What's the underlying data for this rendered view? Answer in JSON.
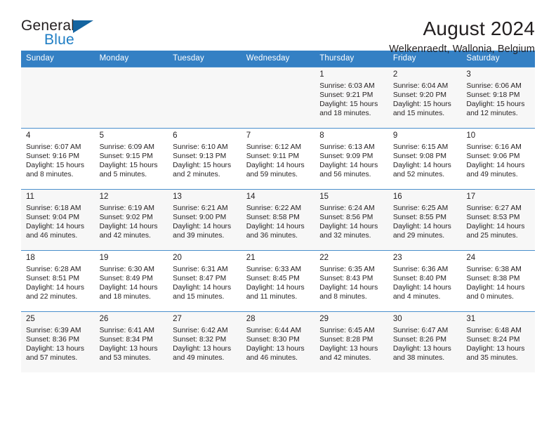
{
  "brand": {
    "name_part1": "General",
    "name_part2": "Blue",
    "accent_color": "#1f7ec4",
    "triangle_color": "#1464a0"
  },
  "header": {
    "title": "August 2024",
    "subtitle": "Welkenraedt, Wallonia, Belgium"
  },
  "theme": {
    "header_row_bg": "#3480c4",
    "header_row_text": "#ffffff",
    "row_shaded_bg": "#f7f7f7",
    "grid_line": "#4a8fcc",
    "text": "#231f20"
  },
  "columns": [
    "Sunday",
    "Monday",
    "Tuesday",
    "Wednesday",
    "Thursday",
    "Friday",
    "Saturday"
  ],
  "labels": {
    "sunrise": "Sunrise:",
    "sunset": "Sunset:",
    "daylight": "Daylight:"
  },
  "weeks": [
    [
      {
        "day": "",
        "detail": ""
      },
      {
        "day": "",
        "detail": ""
      },
      {
        "day": "",
        "detail": ""
      },
      {
        "day": "",
        "detail": ""
      },
      {
        "day": "1",
        "detail": "Sunrise: 6:03 AM\nSunset: 9:21 PM\nDaylight: 15 hours\nand 18 minutes."
      },
      {
        "day": "2",
        "detail": "Sunrise: 6:04 AM\nSunset: 9:20 PM\nDaylight: 15 hours\nand 15 minutes."
      },
      {
        "day": "3",
        "detail": "Sunrise: 6:06 AM\nSunset: 9:18 PM\nDaylight: 15 hours\nand 12 minutes."
      }
    ],
    [
      {
        "day": "4",
        "detail": "Sunrise: 6:07 AM\nSunset: 9:16 PM\nDaylight: 15 hours\nand 8 minutes."
      },
      {
        "day": "5",
        "detail": "Sunrise: 6:09 AM\nSunset: 9:15 PM\nDaylight: 15 hours\nand 5 minutes."
      },
      {
        "day": "6",
        "detail": "Sunrise: 6:10 AM\nSunset: 9:13 PM\nDaylight: 15 hours\nand 2 minutes."
      },
      {
        "day": "7",
        "detail": "Sunrise: 6:12 AM\nSunset: 9:11 PM\nDaylight: 14 hours\nand 59 minutes."
      },
      {
        "day": "8",
        "detail": "Sunrise: 6:13 AM\nSunset: 9:09 PM\nDaylight: 14 hours\nand 56 minutes."
      },
      {
        "day": "9",
        "detail": "Sunrise: 6:15 AM\nSunset: 9:08 PM\nDaylight: 14 hours\nand 52 minutes."
      },
      {
        "day": "10",
        "detail": "Sunrise: 6:16 AM\nSunset: 9:06 PM\nDaylight: 14 hours\nand 49 minutes."
      }
    ],
    [
      {
        "day": "11",
        "detail": "Sunrise: 6:18 AM\nSunset: 9:04 PM\nDaylight: 14 hours\nand 46 minutes."
      },
      {
        "day": "12",
        "detail": "Sunrise: 6:19 AM\nSunset: 9:02 PM\nDaylight: 14 hours\nand 42 minutes."
      },
      {
        "day": "13",
        "detail": "Sunrise: 6:21 AM\nSunset: 9:00 PM\nDaylight: 14 hours\nand 39 minutes."
      },
      {
        "day": "14",
        "detail": "Sunrise: 6:22 AM\nSunset: 8:58 PM\nDaylight: 14 hours\nand 36 minutes."
      },
      {
        "day": "15",
        "detail": "Sunrise: 6:24 AM\nSunset: 8:56 PM\nDaylight: 14 hours\nand 32 minutes."
      },
      {
        "day": "16",
        "detail": "Sunrise: 6:25 AM\nSunset: 8:55 PM\nDaylight: 14 hours\nand 29 minutes."
      },
      {
        "day": "17",
        "detail": "Sunrise: 6:27 AM\nSunset: 8:53 PM\nDaylight: 14 hours\nand 25 minutes."
      }
    ],
    [
      {
        "day": "18",
        "detail": "Sunrise: 6:28 AM\nSunset: 8:51 PM\nDaylight: 14 hours\nand 22 minutes."
      },
      {
        "day": "19",
        "detail": "Sunrise: 6:30 AM\nSunset: 8:49 PM\nDaylight: 14 hours\nand 18 minutes."
      },
      {
        "day": "20",
        "detail": "Sunrise: 6:31 AM\nSunset: 8:47 PM\nDaylight: 14 hours\nand 15 minutes."
      },
      {
        "day": "21",
        "detail": "Sunrise: 6:33 AM\nSunset: 8:45 PM\nDaylight: 14 hours\nand 11 minutes."
      },
      {
        "day": "22",
        "detail": "Sunrise: 6:35 AM\nSunset: 8:43 PM\nDaylight: 14 hours\nand 8 minutes."
      },
      {
        "day": "23",
        "detail": "Sunrise: 6:36 AM\nSunset: 8:40 PM\nDaylight: 14 hours\nand 4 minutes."
      },
      {
        "day": "24",
        "detail": "Sunrise: 6:38 AM\nSunset: 8:38 PM\nDaylight: 14 hours\nand 0 minutes."
      }
    ],
    [
      {
        "day": "25",
        "detail": "Sunrise: 6:39 AM\nSunset: 8:36 PM\nDaylight: 13 hours\nand 57 minutes."
      },
      {
        "day": "26",
        "detail": "Sunrise: 6:41 AM\nSunset: 8:34 PM\nDaylight: 13 hours\nand 53 minutes."
      },
      {
        "day": "27",
        "detail": "Sunrise: 6:42 AM\nSunset: 8:32 PM\nDaylight: 13 hours\nand 49 minutes."
      },
      {
        "day": "28",
        "detail": "Sunrise: 6:44 AM\nSunset: 8:30 PM\nDaylight: 13 hours\nand 46 minutes."
      },
      {
        "day": "29",
        "detail": "Sunrise: 6:45 AM\nSunset: 8:28 PM\nDaylight: 13 hours\nand 42 minutes."
      },
      {
        "day": "30",
        "detail": "Sunrise: 6:47 AM\nSunset: 8:26 PM\nDaylight: 13 hours\nand 38 minutes."
      },
      {
        "day": "31",
        "detail": "Sunrise: 6:48 AM\nSunset: 8:24 PM\nDaylight: 13 hours\nand 35 minutes."
      }
    ]
  ]
}
